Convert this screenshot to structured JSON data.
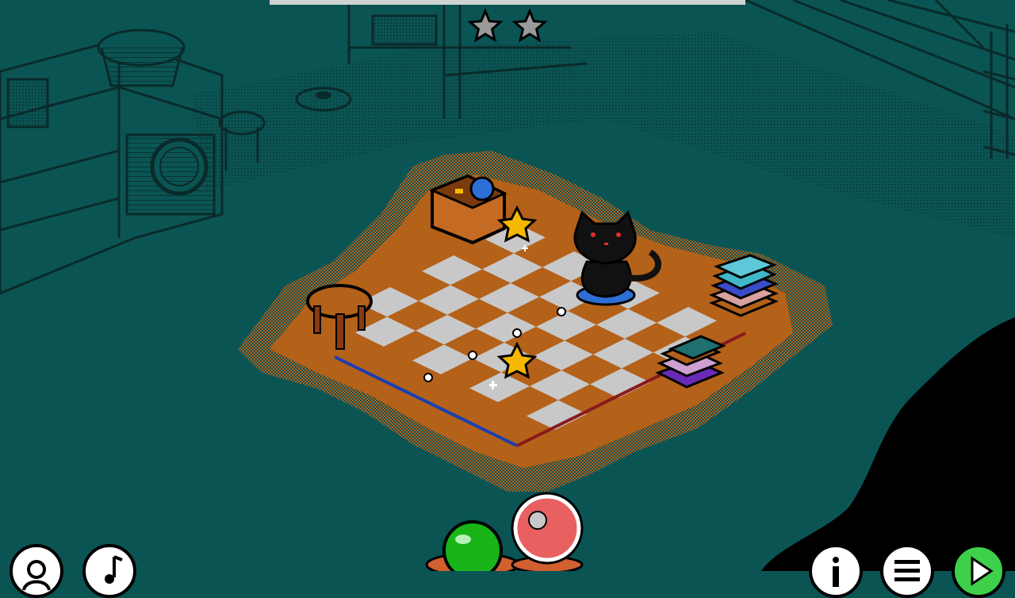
{
  "level": {
    "stars_total": 2,
    "stars_earned": 0,
    "progress": 1.0
  },
  "colors": {
    "background": "#0b5454",
    "line_art": "#0a2a2a",
    "rug": "#b4611a",
    "tile_dark": "#b4611a",
    "tile_light": "#c8c8c8",
    "star": "#f6b800",
    "cat": "#111111",
    "ball_green": "#18b418",
    "ball_red": "#e86060"
  },
  "board": {
    "rows": 6,
    "cols": 8
  },
  "hud": {
    "left_buttons": [
      "character-icon",
      "music-icon"
    ],
    "right_buttons": [
      "info-icon",
      "menu-icon",
      "play-icon"
    ]
  }
}
